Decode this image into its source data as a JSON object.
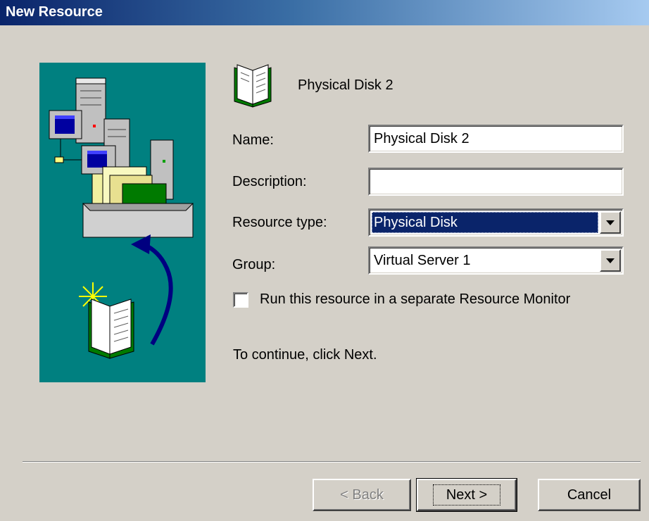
{
  "window": {
    "title": "New Resource"
  },
  "header": {
    "title": "Physical Disk 2",
    "icon": "open-book-icon"
  },
  "form": {
    "name_label": "Name:",
    "name_value": "Physical Disk 2",
    "description_label": "Description:",
    "description_value": "",
    "resource_type_label": "Resource type:",
    "resource_type_value": "Physical Disk",
    "group_label": "Group:",
    "group_value": "Virtual Server 1",
    "monitor_checkbox_label": "Run this resource in a separate Resource Monitor",
    "monitor_checked": false
  },
  "info_text": "To continue, click Next.",
  "buttons": {
    "back": "< Back",
    "next": "Next >",
    "cancel": "Cancel"
  },
  "colors": {
    "title_bar": "#0a246a",
    "dialog_bg": "#d4d0c8",
    "art_bg": "#008080",
    "selection": "#0a246a"
  },
  "illustration": {
    "icons": [
      "computer-icon",
      "server-icon",
      "folder-icon",
      "tray-icon",
      "arrow-icon",
      "sparkle-book-icon"
    ]
  }
}
